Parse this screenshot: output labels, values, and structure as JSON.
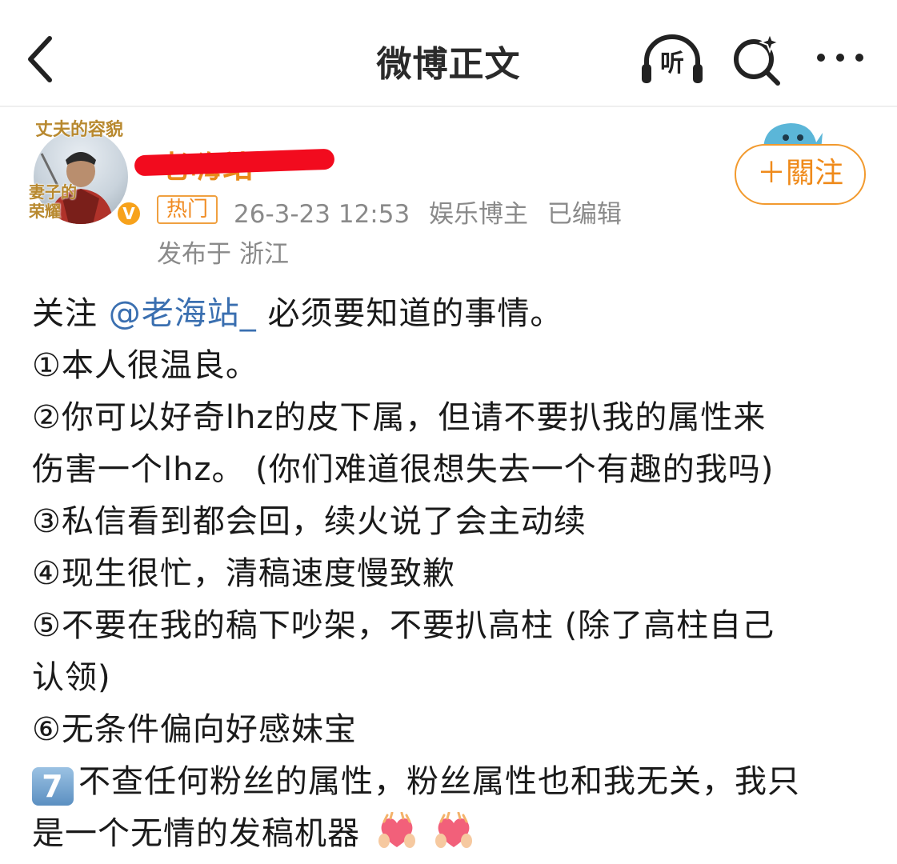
{
  "nav": {
    "title": "微博正文",
    "listen_label": "听"
  },
  "author": {
    "name": "老嗨站",
    "avatar_frame_text_top": "丈夫的容貌",
    "avatar_frame_text_bottom": "妻子的荣耀",
    "verified_symbol": "V"
  },
  "post_meta": {
    "hot_tag": "热门",
    "time": "26-3-23 12:53",
    "category": "娱乐博主",
    "edited": "已编辑",
    "location_prefix": "发布于",
    "location": "浙江"
  },
  "follow_button": "＋關注",
  "content": {
    "line1_prefix": "关注",
    "line1_mention": "@老海站_",
    "line1_suffix": "必须要知道的事情。",
    "line2": "①本人很温良。",
    "line3": "②你可以好奇lhz的皮下属，但请不要扒我的属性来",
    "line4": "伤害一个lhz。 (你们难道很想失去一个有趣的我吗)",
    "line5": "③私信看到都会回，续火说了会主动续",
    "line6": "④现生很忙，清稿速度慢致歉",
    "line7": "⑤不要在我的稿下吵架，不要扒高柱 (除了高柱自己",
    "line8": "认领)",
    "line9": "⑥无条件偏向好感妹宝",
    "line10_badge": "7",
    "line10": "不查任何粉丝的属性，粉丝属性也和我无关，我只",
    "line11": "是一个无情的发稿机器"
  },
  "colors": {
    "accent_orange": "#ef8a1a",
    "mention_blue": "#3a6fb0",
    "meta_gray": "#8a8a8a",
    "redaction_red": "#f20b1e"
  },
  "icons": [
    "back-icon",
    "listen-headphones-icon",
    "search-sparkle-icon",
    "more-icon",
    "verified-icon",
    "mascot-icon",
    "heart-hands-icon"
  ]
}
